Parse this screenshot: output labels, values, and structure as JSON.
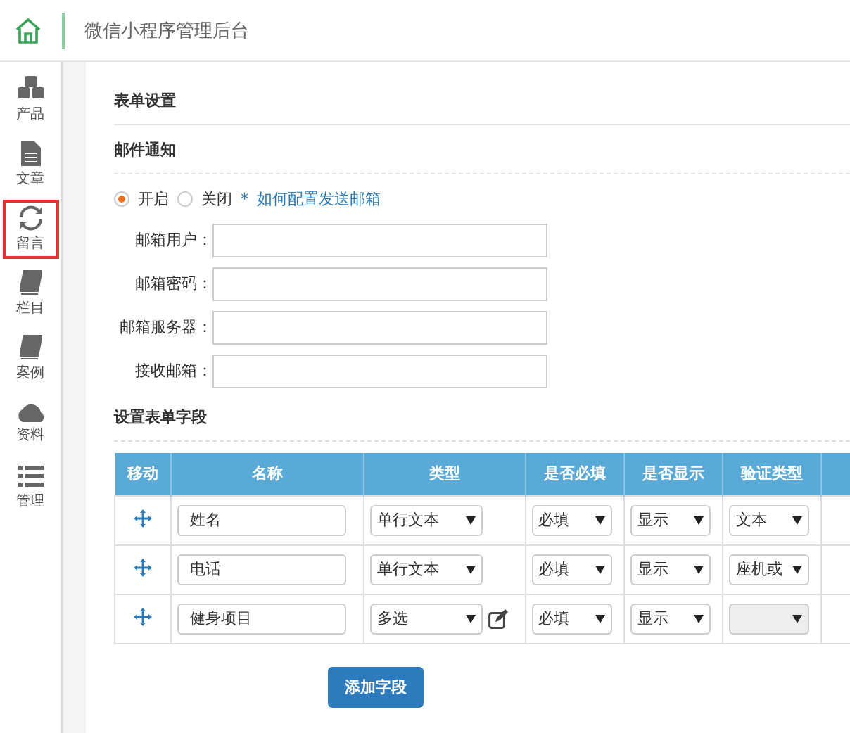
{
  "header": {
    "title": "微信小程序管理后台"
  },
  "sidebar": {
    "items": [
      {
        "label": "产品",
        "selected": false
      },
      {
        "label": "文章",
        "selected": false
      },
      {
        "label": "留言",
        "selected": true
      },
      {
        "label": "栏目",
        "selected": false
      },
      {
        "label": "案例",
        "selected": false
      },
      {
        "label": "资料",
        "selected": false
      },
      {
        "label": "管理",
        "selected": false
      }
    ]
  },
  "panel_title": "表单设置",
  "mail": {
    "title": "邮件通知",
    "options": [
      {
        "label": "开启",
        "selected": true
      },
      {
        "label": "关闭",
        "selected": false
      }
    ],
    "help_mark": "*",
    "help_link": "如何配置发送邮箱",
    "fields": [
      {
        "label": "邮箱用户："
      },
      {
        "label": "邮箱密码："
      },
      {
        "label": "邮箱服务器："
      },
      {
        "label": "接收邮箱："
      }
    ]
  },
  "form_fields": {
    "title": "设置表单字段",
    "columns": [
      "移动",
      "名称",
      "类型",
      "是否必填",
      "是否显示",
      "验证类型"
    ],
    "rows": [
      {
        "name": "姓名",
        "type": "单行文本",
        "edit_icon": false,
        "required": "必填",
        "display": "显示",
        "validation": "文本",
        "validation_disabled": false
      },
      {
        "name": "电话",
        "type": "单行文本",
        "edit_icon": false,
        "required": "必填",
        "display": "显示",
        "validation": "座机或",
        "validation_disabled": false
      },
      {
        "name": "健身项目",
        "type": "多选",
        "edit_icon": true,
        "required": "必填",
        "display": "显示",
        "validation_disabled": true
      }
    ],
    "add_button": "添加字段"
  }
}
